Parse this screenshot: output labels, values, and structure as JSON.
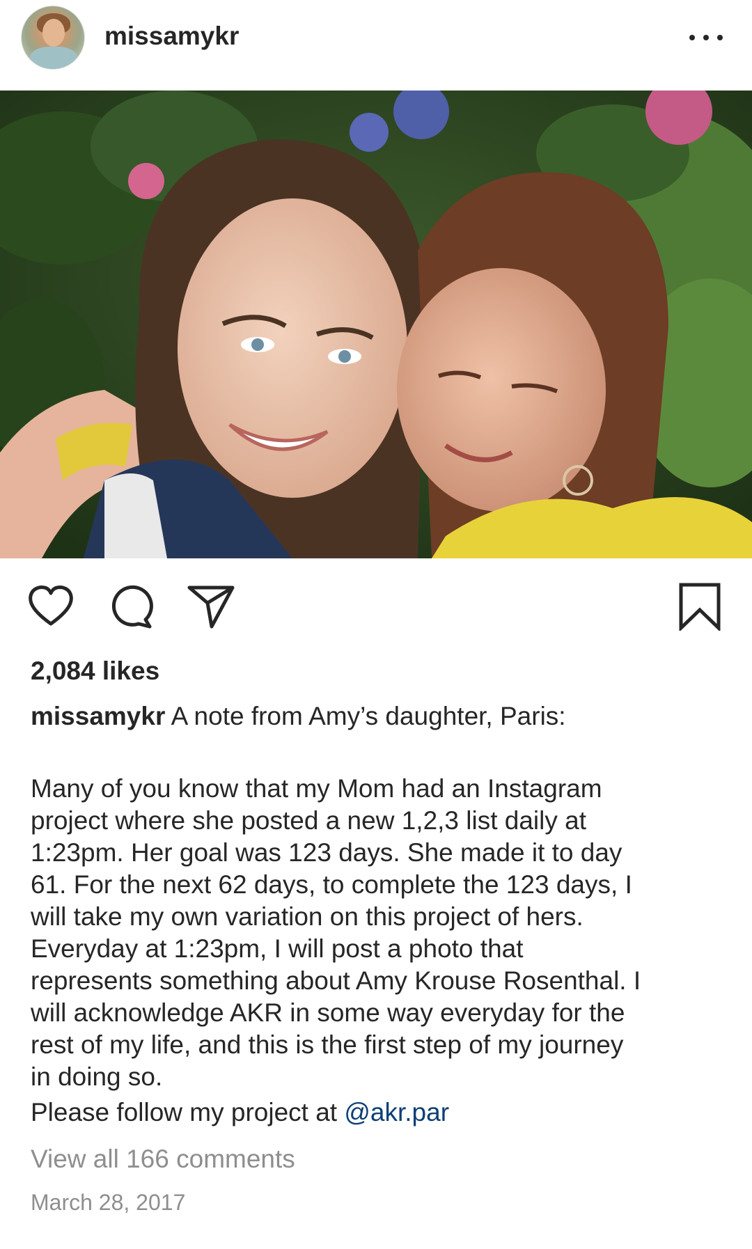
{
  "header": {
    "username": "missamykr",
    "more_icon": "more-horizontal-icon"
  },
  "photo": {
    "alt": "",
    "colors": {
      "foliage": "#2f4a22",
      "hydrangea_pink": "#d4658f",
      "hydrangea_blue": "#4f5fa8",
      "jacket_yellow": "#e8d23a"
    }
  },
  "actions": {
    "like_icon": "heart-icon",
    "comment_icon": "comment-bubble-icon",
    "share_icon": "paper-plane-icon",
    "save_icon": "bookmark-icon"
  },
  "likes_text": "2,084 likes",
  "caption": {
    "username": "missamykr",
    "intro": "A note from Amy’s daughter, Paris:",
    "body_lines": [
      "Many of you know that my Mom had an Instagram",
      "project where she posted a new 1,2,3 list daily at",
      "1:23pm. Her goal was 123 days. She made it to day",
      "61. For the next 62 days, to complete the 123 days, I",
      "will take my own variation on this project of hers.",
      "Everyday at 1:23pm, I will post a photo that",
      "represents something about Amy Krouse Rosenthal. I",
      "will acknowledge AKR in some way everyday for the",
      "rest of my life, and this is the first step of my journey",
      "in doing so."
    ],
    "follow_prefix": "Please follow my project at ",
    "follow_mention": "@akr.par"
  },
  "comments_link": "View all 166 comments",
  "date": "March 28, 2017",
  "colors": {
    "text": "#262626",
    "muted": "#8e8e8e",
    "link": "#0d3f75"
  }
}
